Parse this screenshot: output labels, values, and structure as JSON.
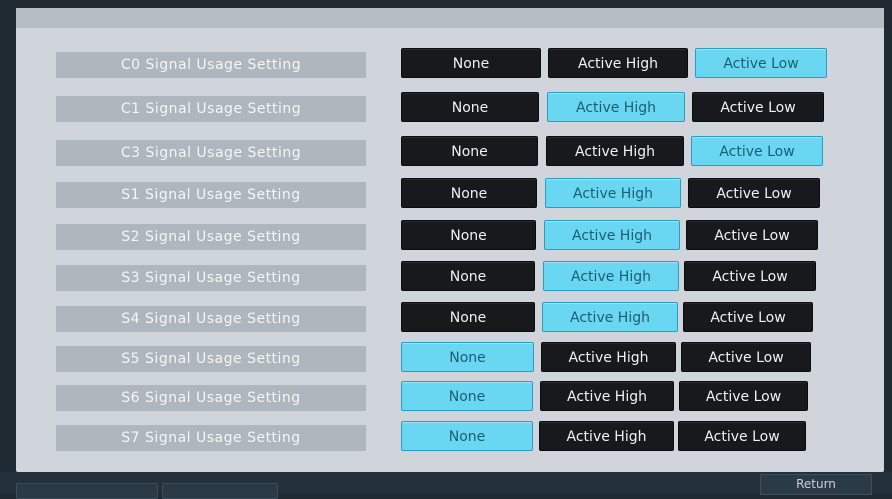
{
  "settings": {
    "rows": [
      {
        "label": "C0 Signal Usage Setting",
        "options": [
          "None",
          "Active High",
          "Active Low"
        ],
        "selected": "Active Low"
      },
      {
        "label": "C1 Signal Usage Setting",
        "options": [
          "None",
          "Active High",
          "Active Low"
        ],
        "selected": "Active High"
      },
      {
        "label": "C3 Signal Usage Setting",
        "options": [
          "None",
          "Active High",
          "Active Low"
        ],
        "selected": "Active Low"
      },
      {
        "label": "S1 Signal Usage Setting",
        "options": [
          "None",
          "Active High",
          "Active Low"
        ],
        "selected": "Active High"
      },
      {
        "label": "S2 Signal Usage Setting",
        "options": [
          "None",
          "Active High",
          "Active Low"
        ],
        "selected": "Active High"
      },
      {
        "label": "S3 Signal Usage Setting",
        "options": [
          "None",
          "Active High",
          "Active Low"
        ],
        "selected": "Active High"
      },
      {
        "label": "S4 Signal Usage Setting",
        "options": [
          "None",
          "Active High",
          "Active Low"
        ],
        "selected": "Active High"
      },
      {
        "label": "S5 Signal Usage Setting",
        "options": [
          "None",
          "Active High",
          "Active Low"
        ],
        "selected": "None"
      },
      {
        "label": "S6 Signal Usage Setting",
        "options": [
          "None",
          "Active High",
          "Active Low"
        ],
        "selected": "None"
      },
      {
        "label": "S7 Signal Usage Setting",
        "options": [
          "None",
          "Active High",
          "Active Low"
        ],
        "selected": "None"
      }
    ]
  },
  "footer": {
    "return_label": "Return"
  },
  "colors": {
    "selected": "#69d7f1",
    "unselected": "#17191c",
    "label_bg": "#b0b6bd"
  }
}
